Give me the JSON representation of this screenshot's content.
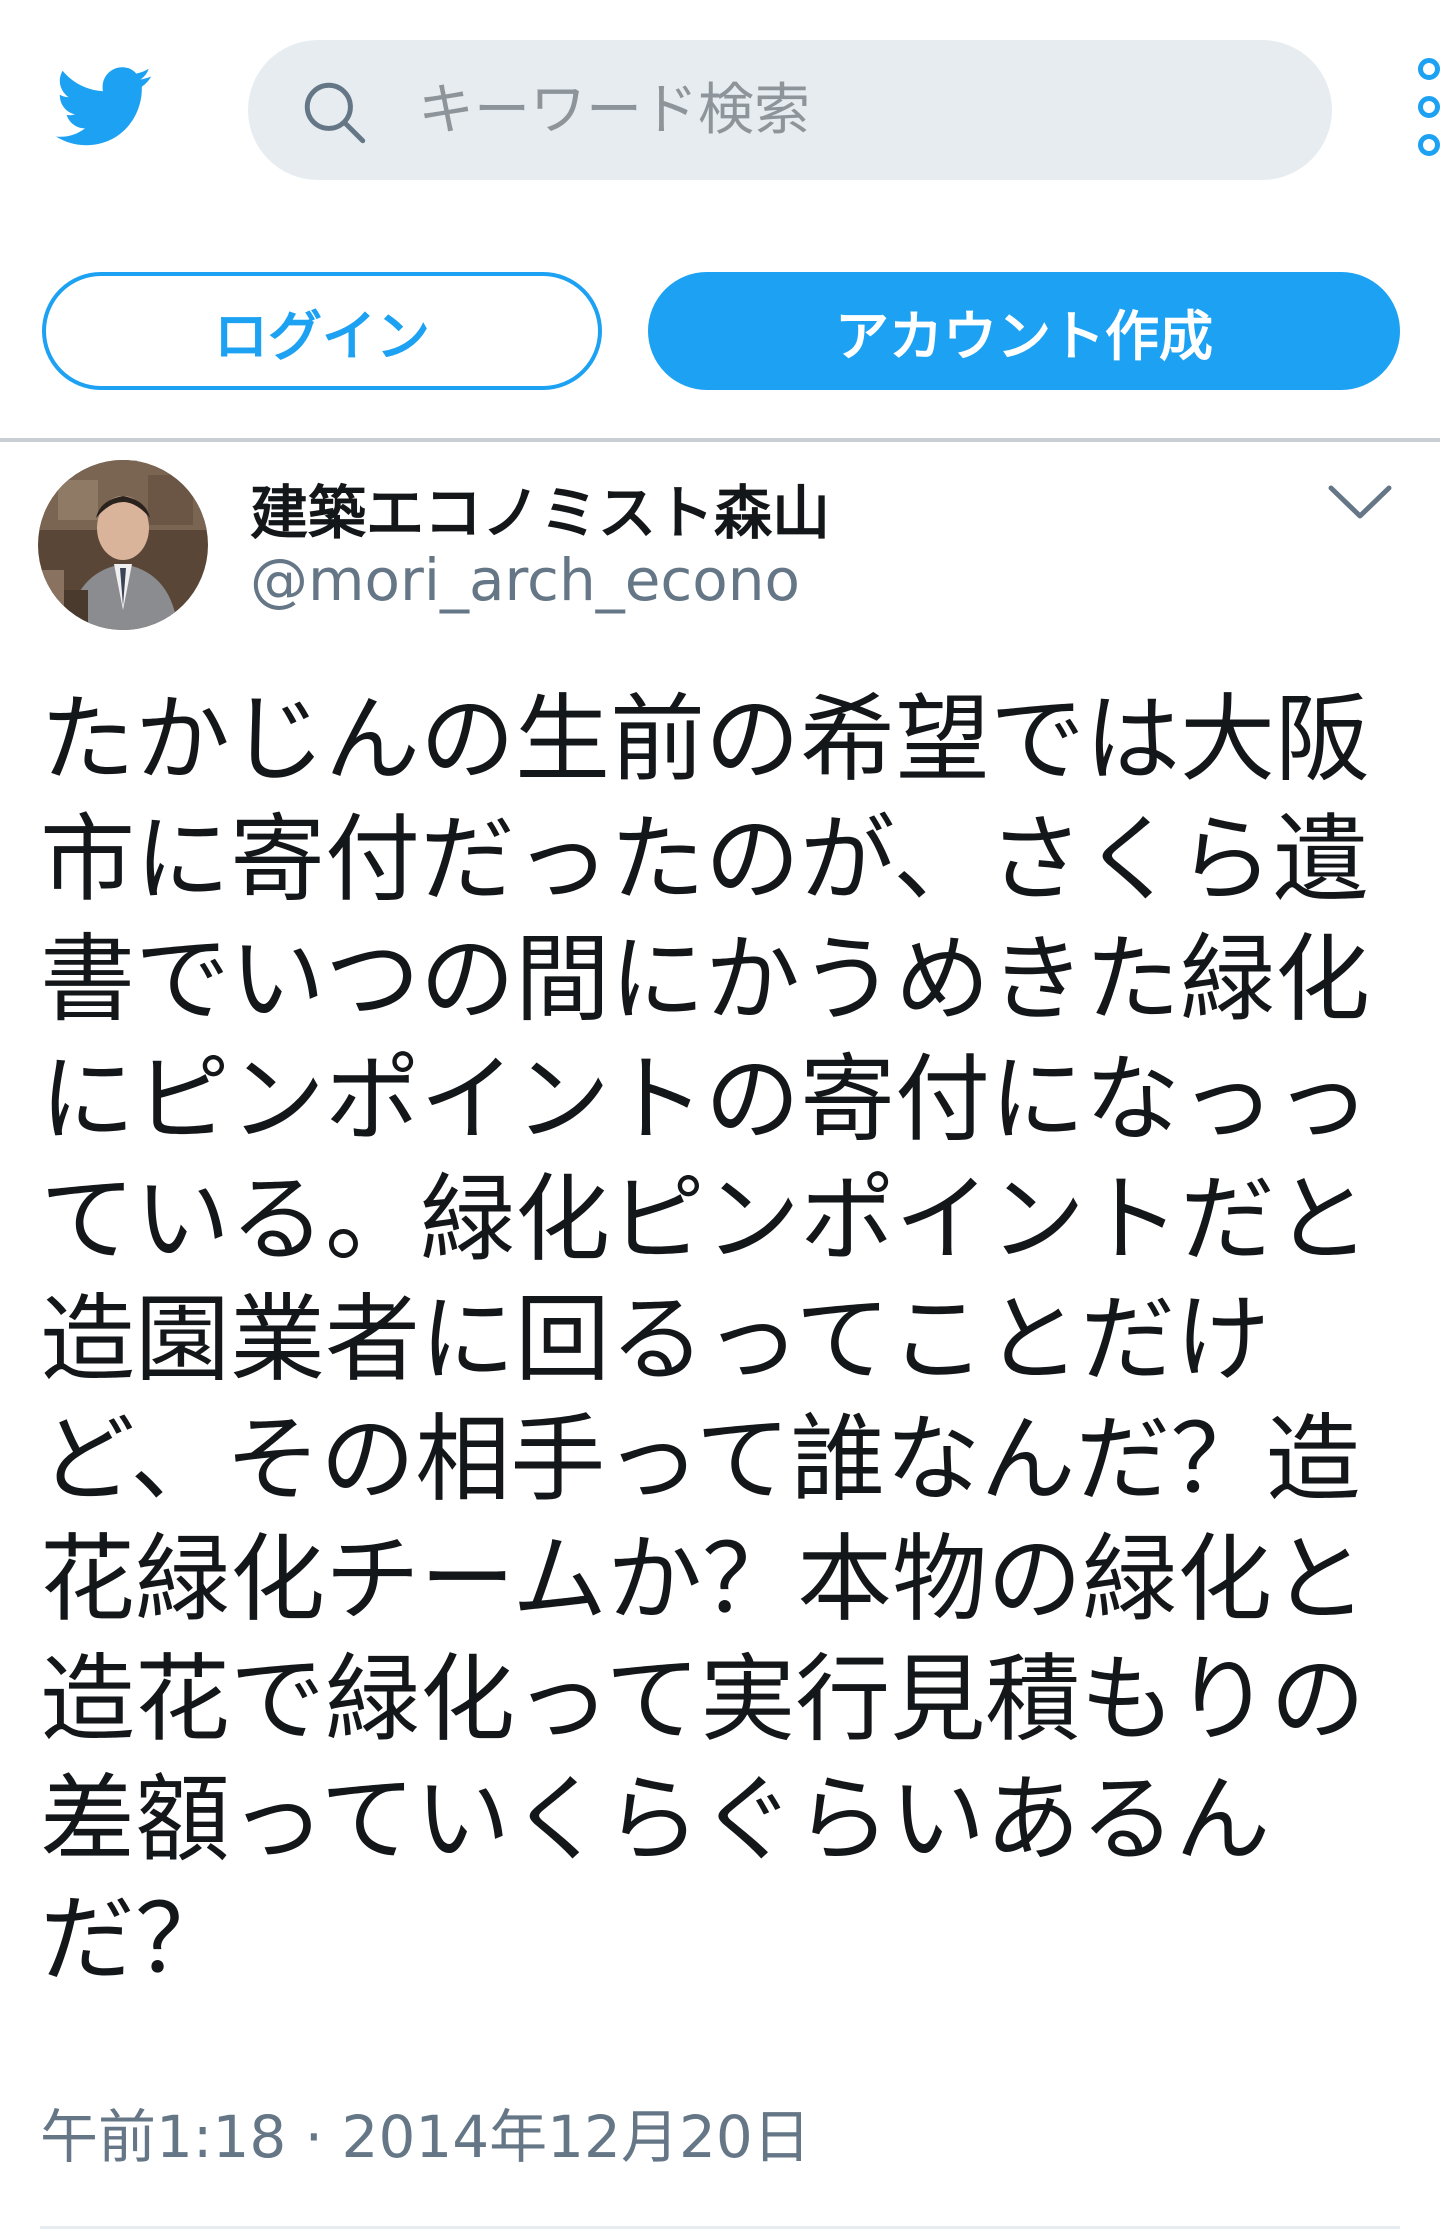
{
  "header": {
    "logo_icon": "twitter-bird-icon",
    "search": {
      "placeholder": "キーワード検索",
      "value": "",
      "icon": "search-icon"
    },
    "more_icon": "more-vertical-icon"
  },
  "auth": {
    "login_label": "ログイン",
    "signup_label": "アカウント作成"
  },
  "tweet": {
    "display_name": "建築エコノミスト森山",
    "handle": "@mori_arch_econo",
    "caret_icon": "chevron-down-icon",
    "lines": [
      "たかじんの生前の希望では大阪",
      "市に寄付だったのが、さくら遺",
      "書でいつの間にかうめきた緑化",
      "にピンポイントの寄付になっっ",
      "ている。緑化ピンポイントだと",
      "造園業者に回るってことだけ",
      "ど、その相手って誰なんだ？造",
      "花緑化チームか？本物の緑化と",
      "造花で緑化って実行見積もりの",
      "差額っていくらぐらいあるん",
      "だ？"
    ],
    "timestamp": "午前1:18 · 2014年12月20日"
  },
  "colors": {
    "accent": "#1da1f2",
    "text": "#14171a",
    "muted": "#657786",
    "search_bg": "#e6ecf0"
  }
}
